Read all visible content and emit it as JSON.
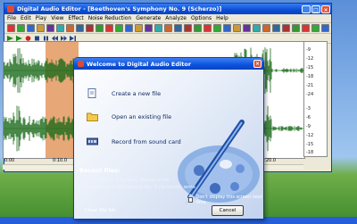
{
  "app": {
    "title": "Digital Audio Editor - [Beethoven's Symphony No. 9 (Scherzo)]",
    "window_buttons": {
      "minimize": "_",
      "maximize": "□",
      "close": "×"
    }
  },
  "menu": [
    "File",
    "Edit",
    "Play",
    "View",
    "Effect",
    "Noise Reduction",
    "Generate",
    "Analyze",
    "Options",
    "Help"
  ],
  "timeline": {
    "labels": [
      "0:00",
      "0:10.0",
      "0:20.0"
    ]
  },
  "scale": {
    "labels": [
      "-9",
      "-12",
      "-15",
      "-18",
      "-21",
      "-24",
      "-3",
      "-6",
      "-9",
      "-12",
      "-15",
      "-18"
    ]
  },
  "dialog": {
    "title": "Welcome to Digital Audio Editor",
    "close_label": "×",
    "actions": [
      {
        "label": "Create a new file",
        "icon": "new-file-icon"
      },
      {
        "label": "Open an existing file",
        "icon": "open-folder-icon"
      },
      {
        "label": "Record from sound card",
        "icon": "sound-card-icon"
      }
    ],
    "recent_heading": "Recent files:",
    "recent_files": [
      "New Stories (Highway Blues).wma",
      "Beethoven's Symphony No. 9 (Scherzo).wma"
    ],
    "dont_display": "Don't display this screen next time",
    "clear_label": "Clear file list",
    "cancel_label": "Cancel"
  },
  "colors": {
    "selection": "#e08a4a",
    "waveform": "#1a6a1a",
    "titlebar": "#0a4fd6"
  }
}
